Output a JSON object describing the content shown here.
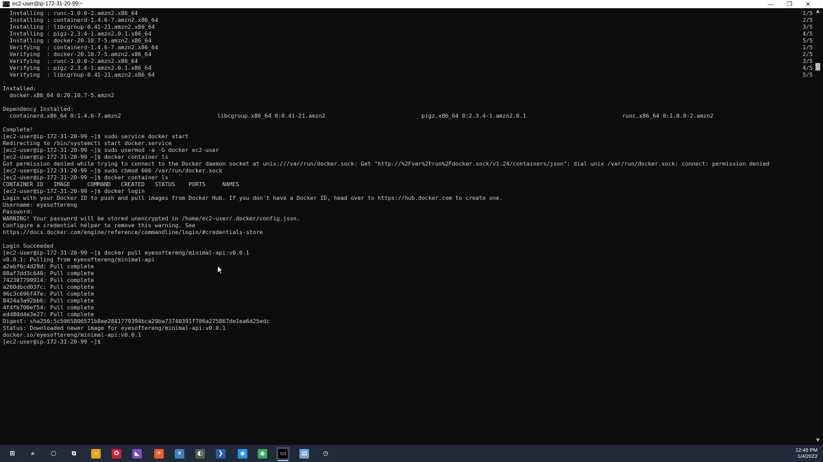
{
  "window": {
    "title": "ec2-user@ip-172-31-20-99:~",
    "app_icon_text": "C:\\",
    "minimize_glyph": "—",
    "restore_glyph": "❐",
    "close_glyph": "✕"
  },
  "terminal": {
    "lines": [
      {
        "segments": [
          "  Installing : runc-1.0.0-2.amzn2.x86_64"
        ],
        "progress": "1/5"
      },
      {
        "segments": [
          "  Installing : containerd-1.4.6-7.amzn2.x86_64"
        ],
        "progress": "2/5"
      },
      {
        "segments": [
          "  Installing : libcgroup-0.41-21.amzn2.x86_64"
        ],
        "progress": "3/5"
      },
      {
        "segments": [
          "  Installing : pigz-2.3.4-1.amzn2.0.1.x86_64"
        ],
        "progress": "4/5"
      },
      {
        "segments": [
          "  Installing : docker-20.10.7-5.amzn2.x86_64"
        ],
        "progress": "5/5"
      },
      {
        "segments": [
          "  Verifying  : containerd-1.4.6-7.amzn2.x86_64"
        ],
        "progress": "1/5"
      },
      {
        "segments": [
          "  Verifying  : docker-20.10.7-5.amzn2.x86_64"
        ],
        "progress": "2/5"
      },
      {
        "segments": [
          "  Verifying  : runc-1.0.0-2.amzn2.x86_64"
        ],
        "progress": "3/5"
      },
      {
        "segments": [
          "  Verifying  : pigz-2.3.4-1.amzn2.0.1.x86_64"
        ],
        "progress": "4/5"
      },
      {
        "segments": [
          "  Verifying  : libcgroup-0.41-21.amzn2.x86_64"
        ],
        "progress": "5/5"
      },
      {
        "segments": [
          ""
        ]
      },
      {
        "segments": [
          "Installed:"
        ]
      },
      {
        "segments": [
          "  docker.x86_64 0:20.10.7-5.amzn2"
        ]
      },
      {
        "segments": [
          ""
        ]
      },
      {
        "segments": [
          "Dependency Installed:"
        ]
      },
      {
        "segments": [
          "  containerd.x86_64 0:1.4.6-7.amzn2",
          "libcgroup.x86_64 0:0.41-21.amzn2",
          "pigz.x86_64 0:2.3.4-1.amzn2.0.1",
          "runc.x86_64 0:1.0.0-2.amzn2"
        ]
      },
      {
        "segments": [
          ""
        ]
      },
      {
        "segments": [
          "Complete!"
        ]
      },
      {
        "segments": [
          "[ec2-user@ip-172-31-20-99 ~]$ sudo service docker start"
        ]
      },
      {
        "segments": [
          "Redirecting to /bin/systemctl start docker.service"
        ]
      },
      {
        "segments": [
          "[ec2-user@ip-172-31-20-99 ~]$ sudo usermod -a -G docker ec2-user"
        ]
      },
      {
        "segments": [
          "[ec2-user@ip-172-31-20-99 ~]$ docker container ls"
        ]
      },
      {
        "segments": [
          "Got permission denied while trying to connect to the Docker daemon socket at unix:///var/run/docker.sock: Get \"http://%2Fvar%2Frun%2Fdocker.sock/v1.24/containers/json\": dial unix /var/run/docker.sock: connect: permission denied"
        ]
      },
      {
        "segments": [
          "[ec2-user@ip-172-31-20-99 ~]$ sudo chmod 666 /var/run/docker.sock"
        ]
      },
      {
        "segments": [
          "[ec2-user@ip-172-31-20-99 ~]$ docker container ls"
        ]
      },
      {
        "segments": [
          "CONTAINER ID   IMAGE     COMMAND   CREATED   STATUS    PORTS     NAMES"
        ]
      },
      {
        "segments": [
          "[ec2-user@ip-172-31-20-99 ~]$ docker login"
        ]
      },
      {
        "segments": [
          "Login with your Docker ID to push and pull images from Docker Hub. If you don't have a Docker ID, head over to https://hub.docker.com to create one."
        ]
      },
      {
        "segments": [
          "Username: eyesoftereng"
        ]
      },
      {
        "segments": [
          "Password:"
        ]
      },
      {
        "segments": [
          "WARNING! Your password will be stored unencrypted in /home/ec2-user/.docker/config.json."
        ]
      },
      {
        "segments": [
          "Configure a credential helper to remove this warning. See"
        ]
      },
      {
        "segments": [
          "https://docs.docker.com/engine/reference/commandline/login/#credentials-store"
        ]
      },
      {
        "segments": [
          ""
        ]
      },
      {
        "segments": [
          "Login Succeeded"
        ]
      },
      {
        "segments": [
          "[ec2-user@ip-172-31-20-99 ~]$ docker pull eyesoftereng/minimal-api:v0.0.1"
        ]
      },
      {
        "segments": [
          "v0.0.1: Pulling from eyesoftereng/minimal-api"
        ]
      },
      {
        "segments": [
          "a2abf6c4d29d: Pull complete"
        ]
      },
      {
        "segments": [
          "08af7dd3c640: Pull complete"
        ]
      },
      {
        "segments": [
          "742307799914: Pull complete"
        ]
      },
      {
        "segments": [
          "a260dbcd03fc: Pull complete"
        ]
      },
      {
        "segments": [
          "96c3c696f47e: Pull complete"
        ]
      },
      {
        "segments": [
          "8424a3a92bb6: Pull complete"
        ]
      },
      {
        "segments": [
          "4f4fb700ef54: Pull complete"
        ]
      },
      {
        "segments": [
          "edd80d4e3e27: Pull complete"
        ]
      },
      {
        "segments": [
          "Digest: sha256:5c5065806571b8ee2841779394bca29ba73740391f706a275867de1ea6d25edc"
        ]
      },
      {
        "segments": [
          "Status: Downloaded newer image for eyesoftereng/minimal-api:v0.0.1"
        ]
      },
      {
        "segments": [
          "docker.io/eyesoftereng/minimal-api:v0.0.1"
        ]
      },
      {
        "segments": [
          "[ec2-user@ip-172-31-20-99 ~]$ "
        ]
      }
    ]
  },
  "scrollbar": {
    "up_glyph": "▲",
    "down_glyph": "▼"
  },
  "taskbar": {
    "items": [
      {
        "name": "windows-start-icon",
        "glyph": "⊞",
        "color": "#ffffff",
        "bg": "transparent"
      },
      {
        "name": "search-icon",
        "glyph": "⌕",
        "color": "#ffffff",
        "bg": "transparent"
      },
      {
        "name": "cortana-icon",
        "glyph": "○",
        "color": "#ffffff",
        "bg": "transparent"
      },
      {
        "name": "task-view-icon",
        "glyph": "⧉",
        "color": "#ffffff",
        "bg": "transparent"
      },
      {
        "name": "file-explorer-icon",
        "glyph": "▬",
        "color": "#f5c542",
        "bg": "#e2a21a"
      },
      {
        "name": "opera-icon",
        "glyph": "O",
        "color": "#ffffff",
        "bg": "#d0202a"
      },
      {
        "name": "visual-studio-icon",
        "glyph": "◣",
        "color": "#ffffff",
        "bg": "#7c4dbd"
      },
      {
        "name": "postman-icon",
        "glyph": "✈",
        "color": "#ffffff",
        "bg": "#ef5b25"
      },
      {
        "name": "sql-management-studio-icon",
        "glyph": "✕",
        "color": "#ffffff",
        "bg": "#3f7fbf"
      },
      {
        "name": "visual-studio-installer-icon",
        "glyph": "◐",
        "color": "#ffffff",
        "bg": "#5a5a5a"
      },
      {
        "name": "powershell-icon",
        "glyph": "❯",
        "color": "#ffffff",
        "bg": "#2a5ba8"
      },
      {
        "name": "docker-icon",
        "glyph": "◆",
        "color": "#ffffff",
        "bg": "#2496ed"
      },
      {
        "name": "chrome-icon",
        "glyph": "◉",
        "color": "#ffffff",
        "bg": "#34a853"
      },
      {
        "name": "terminal-icon",
        "glyph": "▭",
        "color": "#ffffff",
        "bg": "#000000"
      },
      {
        "name": "notepad-icon",
        "glyph": "▤",
        "color": "#ffffff",
        "bg": "#6fa3d6"
      },
      {
        "name": "clock-app-icon",
        "glyph": "◷",
        "color": "#ffffff",
        "bg": "transparent"
      }
    ],
    "time": "12:45 PM",
    "date": "1/4/2022"
  }
}
